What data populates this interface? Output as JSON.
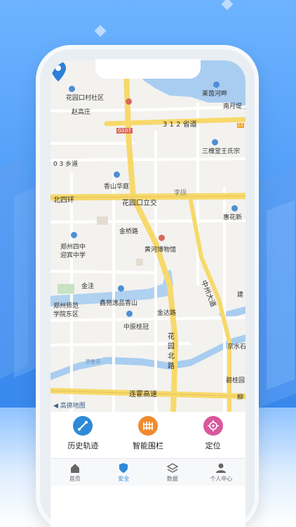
{
  "map": {
    "labels": {
      "huayuankou_village": "花园口村社区",
      "laiyin_river": "莱茵河畔",
      "nanyue_di": "南月堤",
      "zhao_gaozhuang": "赵高庄",
      "g107": "G107",
      "provincial_312": "3 1 2 省道",
      "s_mark": "S3",
      "wangshi": "三槐堂王氏宗",
      "xiang_03": "0 3 乡道",
      "xiangshan_huating": "香山华庭",
      "lizhuang": "李拐",
      "beisihuan": "北四环",
      "huayuankou_interchange": "花园口立交",
      "huihua_xin": "惠花新",
      "jinqiao_road": "金桥路",
      "zz_no4_middle_1": "郑州四中",
      "zz_no4_middle_2": "迎宾中学",
      "huanghe_museum": "黄河博物馆",
      "jinwa": "金洼",
      "zhongzhou_avenue": "中州大道",
      "jian": "建",
      "normal_college_1": "郑州师范",
      "normal_college_2": "学院东区",
      "xinyuan": "鑫苑逸品香山",
      "jinda_road": "金达路",
      "zhongyuan_guiguan": "中原桂冠",
      "huayuan_north_1": "花",
      "huayuan_north_2": "园",
      "huayuan_north_3": "北",
      "huayuan_north_4": "路",
      "jingshui": "京水石",
      "jialu_river": "贾鲁河",
      "biguiyuan": "碧桂园",
      "lianhuo_expressway": "连霍高速",
      "liu": "柳",
      "amap_logo": "高德地图"
    }
  },
  "features": [
    {
      "label": "历史轨迹",
      "icon": "history-track-icon",
      "color": "#2e8ad8"
    },
    {
      "label": "智能围栏",
      "icon": "fence-icon",
      "color": "#f08a2c"
    },
    {
      "label": "定位",
      "icon": "locate-icon",
      "color": "#d8589c"
    }
  ],
  "tabs": [
    {
      "label": "首页",
      "icon": "home-icon",
      "active": false
    },
    {
      "label": "安全",
      "icon": "shield-icon",
      "active": true
    },
    {
      "label": "数据",
      "icon": "layers-icon",
      "active": false
    },
    {
      "label": "个人中心",
      "icon": "person-icon",
      "active": false
    }
  ],
  "colors": {
    "accent": "#2e8ad8",
    "road_major": "#f7d96b",
    "river": "#a9cdf0"
  }
}
